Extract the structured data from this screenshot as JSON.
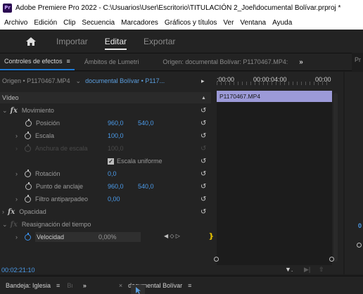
{
  "window": {
    "logo": "Pr",
    "title": "Adobe Premiere Pro 2022 - C:\\Usuarios\\User\\Escritorio\\TITULACIÓN 2_Joel\\documental Bolívar.prproj *"
  },
  "menu": [
    "Archivo",
    "Edición",
    "Clip",
    "Secuencia",
    "Marcadores",
    "Gráficos y títulos",
    "Ver",
    "Ventana",
    "Ayuda"
  ],
  "workspace": {
    "tabs": [
      "Importar",
      "Editar",
      "Exportar"
    ],
    "active": "Editar"
  },
  "panel_tabs": {
    "effect_controls": "Controles de efectos",
    "menu_glyph": "≡",
    "lumetri": "Ámbitos de Lumetri",
    "source": "Origen: documental Bolívar: P1170467.MP4:",
    "more": "»",
    "right_partial": "Pr"
  },
  "effect_controls": {
    "source_clip": "Origen • P1170467.MP4",
    "sequence_clip": "documental Bolívar • P117...",
    "video_label": "Vídeo",
    "properties": {
      "motion": "Movimiento",
      "position": {
        "label": "Posición",
        "x": "960,0",
        "y": "540,0"
      },
      "scale": {
        "label": "Escala",
        "value": "100,0"
      },
      "scale_width": {
        "label": "Anchura de escala",
        "value": "100,0"
      },
      "uniform_scale": "Escala uniforme",
      "rotation": {
        "label": "Rotación",
        "value": "0,0"
      },
      "anchor": {
        "label": "Punto de anclaje",
        "x": "960,0",
        "y": "540,0"
      },
      "antiflicker": {
        "label": "Filtro antiparpadeo",
        "value": "0,00"
      },
      "opacity": "Opacidad",
      "time_remap": "Reasignación del tiempo",
      "speed": {
        "label": "Velocidad",
        "value": "0,00%"
      }
    },
    "timeline": {
      "ruler": [
        ":00:00",
        "00:00:04:00",
        "00:00"
      ],
      "clip_name": "P1170467.MP4"
    },
    "timecode": "00:02:21:10"
  },
  "right_panel_partial": "0",
  "bottom": {
    "bin_tab": "Bandeja: Iglesia",
    "b_partial": "Bı",
    "more": "»",
    "sequence_tab": "documental Bolívar"
  },
  "colors": {
    "accent_blue": "#4b9bea",
    "clip_purple": "#9c9ad8",
    "keyframe_yellow": "#e6c200"
  }
}
